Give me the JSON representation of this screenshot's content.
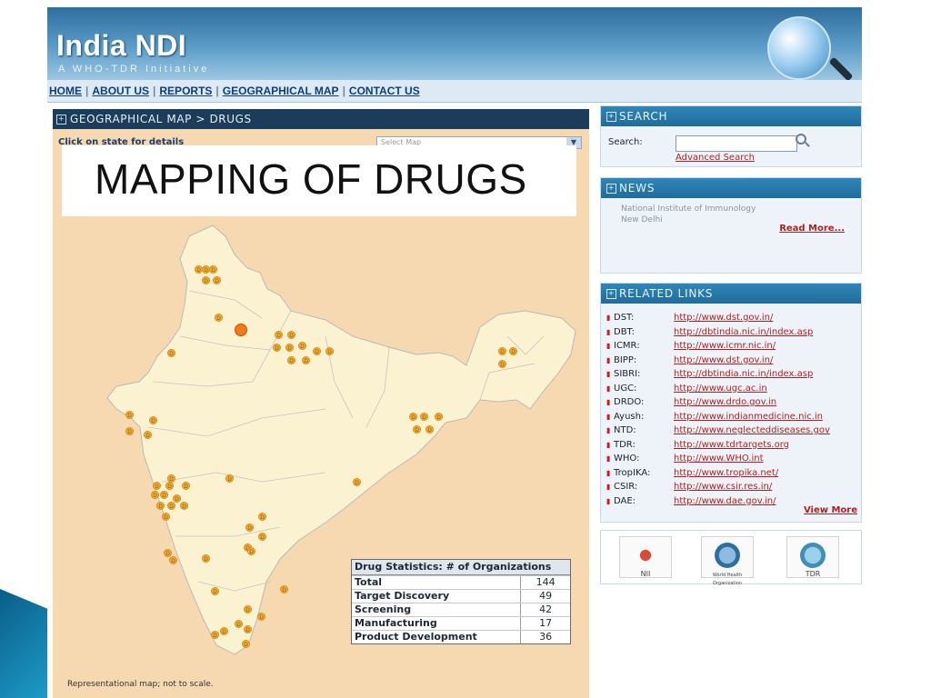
{
  "header": {
    "logo_text": "India NDI",
    "logo_subtitle": "A WHO-TDR Initiative",
    "globe_icon": "globe-magnifier-icon"
  },
  "nav": {
    "items": [
      "HOME",
      "ABOUT US",
      "REPORTS",
      "GEOGRAPHICAL MAP",
      "CONTACT US"
    ]
  },
  "map": {
    "header": "GEOGRAPHICAL MAP > DRUGS",
    "click_label": "Click on state for details",
    "select_value": "Select Map",
    "overlay_title": "MAPPING OF DRUGS",
    "note": "Representational map; not to scale.",
    "marker_letter": "D",
    "colors": {
      "land": "#fbf2d2",
      "sea": "#f6d9b0",
      "marker": "#f2b33a",
      "marker_big": "#f07a1a"
    }
  },
  "stats": {
    "header": "Drug Statistics:   # of Organizations",
    "rows": [
      {
        "label": "Total",
        "value": "144"
      },
      {
        "label": "Target Discovery",
        "value": "49"
      },
      {
        "label": "Screening",
        "value": "42"
      },
      {
        "label": "Manufacturing",
        "value": "17"
      },
      {
        "label": "Product Development",
        "value": "36"
      }
    ]
  },
  "search": {
    "title": "SEARCH",
    "label": "Search:",
    "input_value": "",
    "advanced_link": "Advanced Search"
  },
  "news": {
    "title": "NEWS",
    "line1": "National Institute of Immunology",
    "line2": "New Delhi",
    "read_more": "Read More..."
  },
  "related": {
    "title": "RELATED LINKS",
    "links": [
      {
        "name": "DST:",
        "url": "http://www.dst.gov.in/"
      },
      {
        "name": "DBT:",
        "url": "http://dbtindia.nic.in/index.asp"
      },
      {
        "name": "ICMR:",
        "url": "http://www.icmr.nic.in/"
      },
      {
        "name": "BIPP:",
        "url": "http://www.dst.gov.in/"
      },
      {
        "name": "SIBRI:",
        "url": "http://dbtindia.nic.in/index.asp"
      },
      {
        "name": "UGC:",
        "url": "http://www.ugc.ac.in"
      },
      {
        "name": "DRDO:",
        "url": "http://www.drdo.gov.in"
      },
      {
        "name": "Ayush:",
        "url": "http://www.indianmedicine.nic.in"
      },
      {
        "name": "NTD:",
        "url": "http://www.neglecteddiseases.gov"
      },
      {
        "name": "TDR:",
        "url": "http://www.tdrtargets.org"
      },
      {
        "name": "WHO:",
        "url": "http://www.WHO.int"
      },
      {
        "name": "TropIKA:",
        "url": "http://www.tropika.net/"
      },
      {
        "name": "CSIR:",
        "url": "http://www.csir.res.in/"
      },
      {
        "name": "DAE:",
        "url": "http://www.dae.gov.in/"
      }
    ],
    "view_more": "View More"
  },
  "logos": {
    "nii": "NII",
    "who": "World Health Organization",
    "tdr": "TDR"
  }
}
